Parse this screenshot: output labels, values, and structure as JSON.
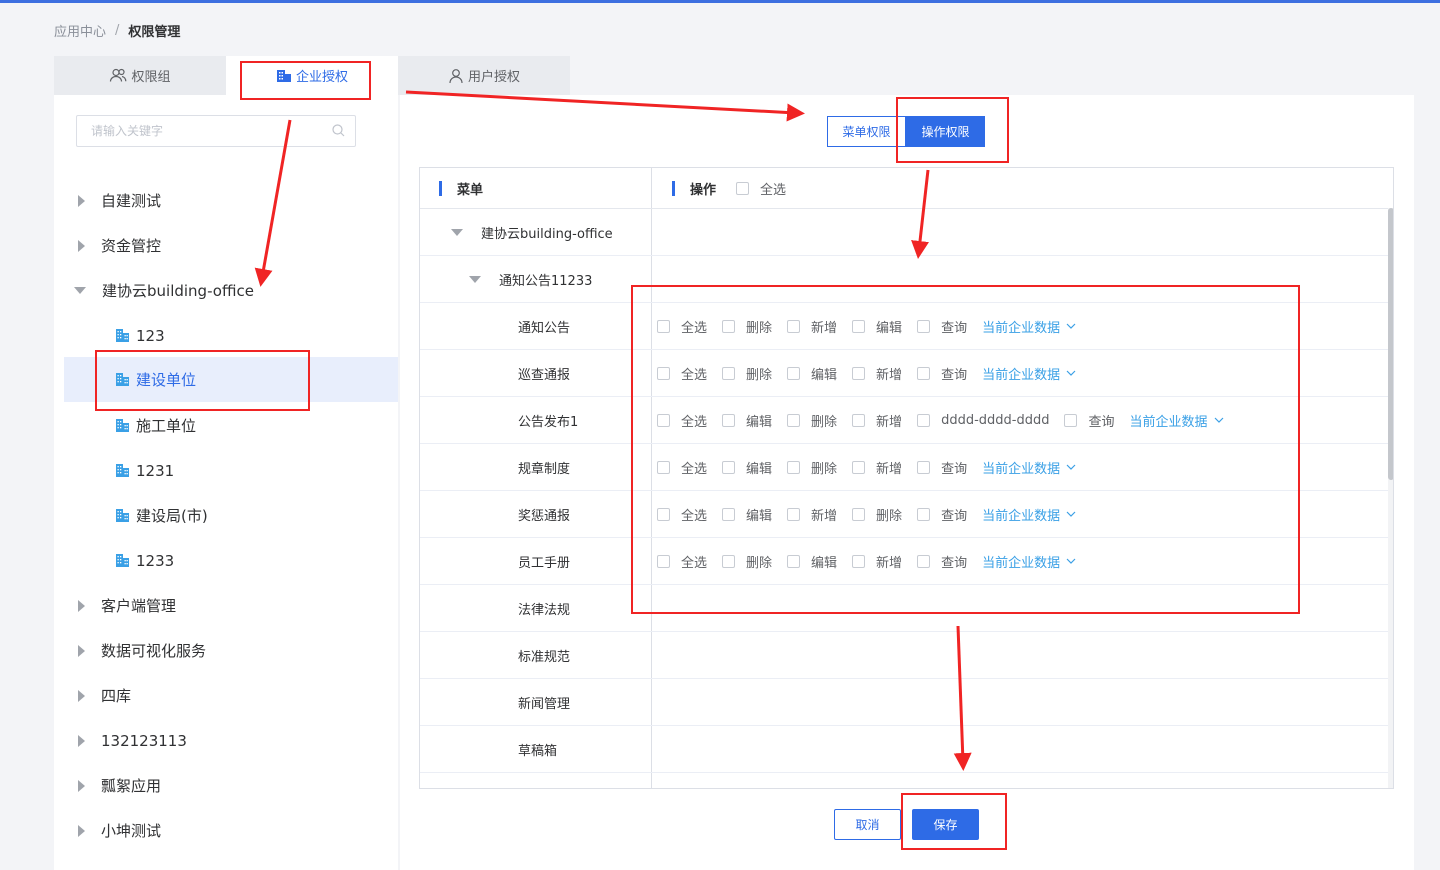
{
  "breadcrumb": {
    "parent": "应用中心",
    "separator": "/",
    "current": "权限管理"
  },
  "tabs": [
    {
      "label": "权限组",
      "icon": "users-icon",
      "active": false
    },
    {
      "label": "企业授权",
      "icon": "building-icon",
      "active": true
    },
    {
      "label": "用户授权",
      "icon": "user-icon",
      "active": false
    }
  ],
  "search": {
    "placeholder": "请输入关键字",
    "value": ""
  },
  "tree": [
    {
      "label": "自建测试",
      "type": "group",
      "expanded": false
    },
    {
      "label": "资金管控",
      "type": "group",
      "expanded": false
    },
    {
      "label": "建协云building-office",
      "type": "group",
      "expanded": true
    },
    {
      "label": "123",
      "type": "org"
    },
    {
      "label": "建设单位",
      "type": "org",
      "selected": true
    },
    {
      "label": "施工单位",
      "type": "org"
    },
    {
      "label": "1231",
      "type": "org"
    },
    {
      "label": "建设局(市)",
      "type": "org"
    },
    {
      "label": "1233",
      "type": "org"
    },
    {
      "label": "客户端管理",
      "type": "group",
      "expanded": false
    },
    {
      "label": "数据可视化服务",
      "type": "group",
      "expanded": false
    },
    {
      "label": "四库",
      "type": "group",
      "expanded": false
    },
    {
      "label": "132123113",
      "type": "group",
      "expanded": false
    },
    {
      "label": "瓢絮应用",
      "type": "group",
      "expanded": false
    },
    {
      "label": "小坤测试",
      "type": "group",
      "expanded": false
    }
  ],
  "segments": {
    "menu_perm": "菜单权限",
    "op_perm": "操作权限"
  },
  "table": {
    "menu_header": "菜单",
    "op_header": "操作",
    "check_all": "全选",
    "rows": [
      {
        "menu": "建协云building-office",
        "level": 0,
        "expandable": true,
        "ops": []
      },
      {
        "menu": "通知公告11233",
        "level": 1,
        "expandable": true,
        "ops": []
      },
      {
        "menu": "通知公告",
        "level": 2,
        "ops": [
          "全选",
          "删除",
          "新增",
          "编辑",
          "查询"
        ],
        "scope": "当前企业数据"
      },
      {
        "menu": "巡查通报",
        "level": 2,
        "ops": [
          "全选",
          "删除",
          "编辑",
          "新增",
          "查询"
        ],
        "scope": "当前企业数据"
      },
      {
        "menu": "公告发布1",
        "level": 2,
        "ops": [
          "全选",
          "编辑",
          "删除",
          "新增",
          "dddd-dddd-dddd",
          "查询"
        ],
        "scope": "当前企业数据"
      },
      {
        "menu": "规章制度",
        "level": 2,
        "ops": [
          "全选",
          "编辑",
          "删除",
          "新增",
          "查询"
        ],
        "scope": "当前企业数据"
      },
      {
        "menu": "奖惩通报",
        "level": 2,
        "ops": [
          "全选",
          "编辑",
          "新增",
          "删除",
          "查询"
        ],
        "scope": "当前企业数据"
      },
      {
        "menu": "员工手册",
        "level": 2,
        "ops": [
          "全选",
          "删除",
          "编辑",
          "新增",
          "查询"
        ],
        "scope": "当前企业数据"
      },
      {
        "menu": "法律法规",
        "level": 2,
        "ops": []
      },
      {
        "menu": "标准规范",
        "level": 2,
        "ops": []
      },
      {
        "menu": "新闻管理",
        "level": 2,
        "ops": []
      },
      {
        "menu": "草稿箱",
        "level": 2,
        "ops": []
      }
    ]
  },
  "buttons": {
    "cancel": "取消",
    "save": "保存"
  },
  "colors": {
    "accent": "#2e6be6",
    "annotation": "#f02424",
    "scope_link": "#3aa0e6"
  }
}
